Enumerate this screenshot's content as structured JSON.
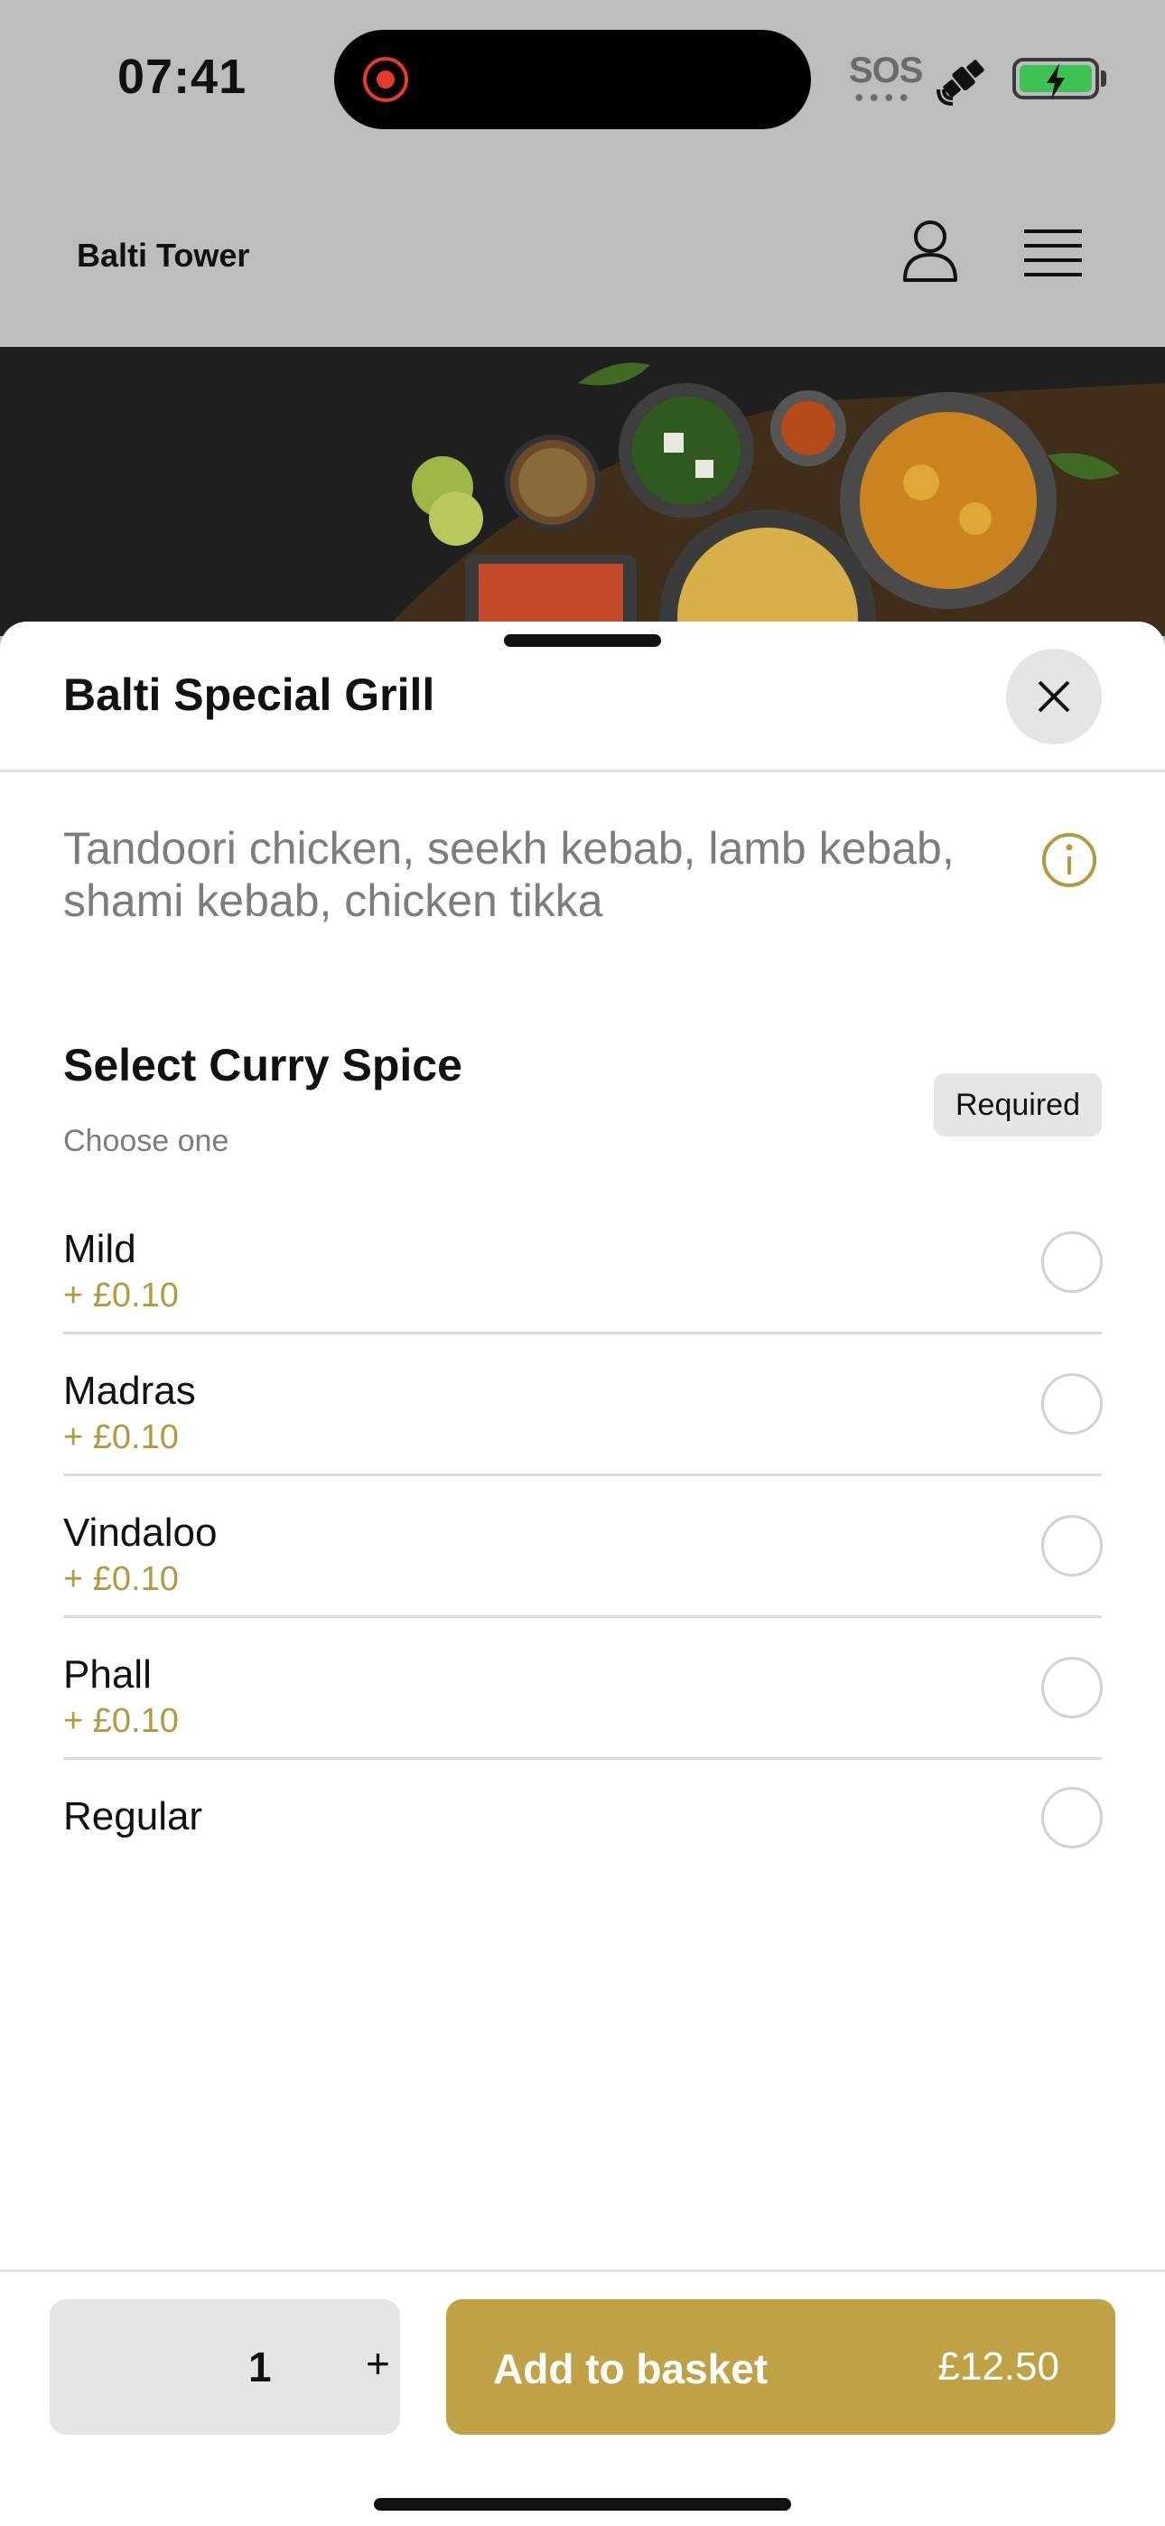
{
  "status_bar": {
    "time": "07:41",
    "sos": "SOS",
    "icons": [
      "screen-recording-icon",
      "satellite-icon",
      "battery-charging-icon"
    ]
  },
  "header": {
    "brand": "Balti Tower",
    "icons": [
      "user-icon",
      "menu-icon"
    ]
  },
  "sheet": {
    "title": "Balti Special Grill",
    "description": "Tandoori chicken, seekh kebab, lamb kebab, shami kebab, chicken tikka",
    "option_group": {
      "title": "Select Curry Spice",
      "subtitle": "Choose one",
      "badge": "Required",
      "options": [
        {
          "name": "Mild",
          "price": "+ £0.10"
        },
        {
          "name": "Madras",
          "price": "+ £0.10"
        },
        {
          "name": "Vindaloo",
          "price": "+ £0.10"
        },
        {
          "name": "Phall",
          "price": "+ £0.10"
        },
        {
          "name": "Regular",
          "price": ""
        }
      ]
    }
  },
  "footer": {
    "quantity": "1",
    "plus": "+",
    "add_label": "Add to basket",
    "total": "£12.50"
  },
  "colors": {
    "accent": "#c0a246",
    "price_text": "#b39a3e",
    "overlay": "#bdbdbd"
  }
}
